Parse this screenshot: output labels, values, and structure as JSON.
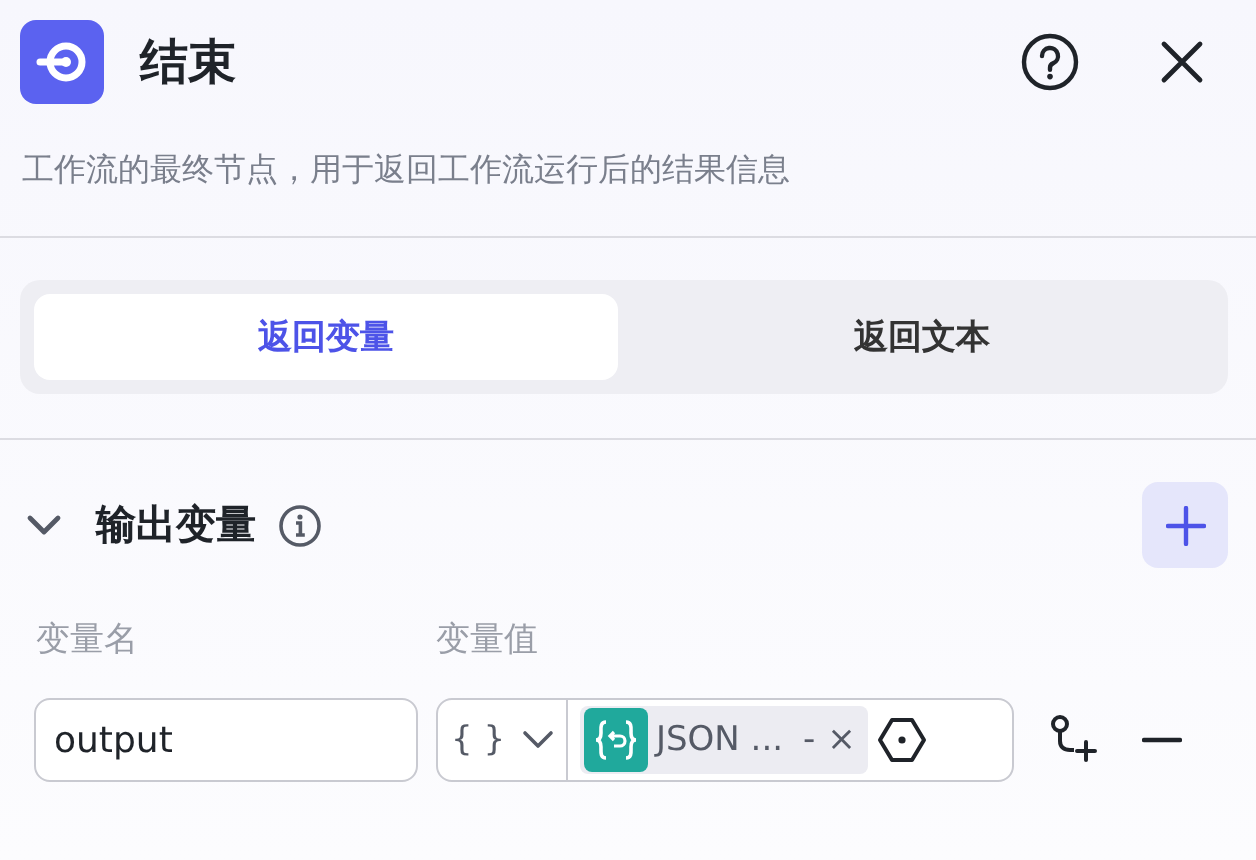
{
  "header": {
    "title": "结束",
    "description": "工作流的最终节点，用于返回工作流运行后的结果信息"
  },
  "tabs": [
    {
      "label": "返回变量",
      "selected": true
    },
    {
      "label": "返回文本",
      "selected": false
    }
  ],
  "section": {
    "title": "输出变量",
    "expanded": true,
    "columns": [
      "变量名",
      "变量值"
    ],
    "rows": [
      {
        "name": "output",
        "type_label": "{ }",
        "ref_label": "JSON ...",
        "ref_dash": "-",
        "ref_remove": "×"
      }
    ]
  }
}
